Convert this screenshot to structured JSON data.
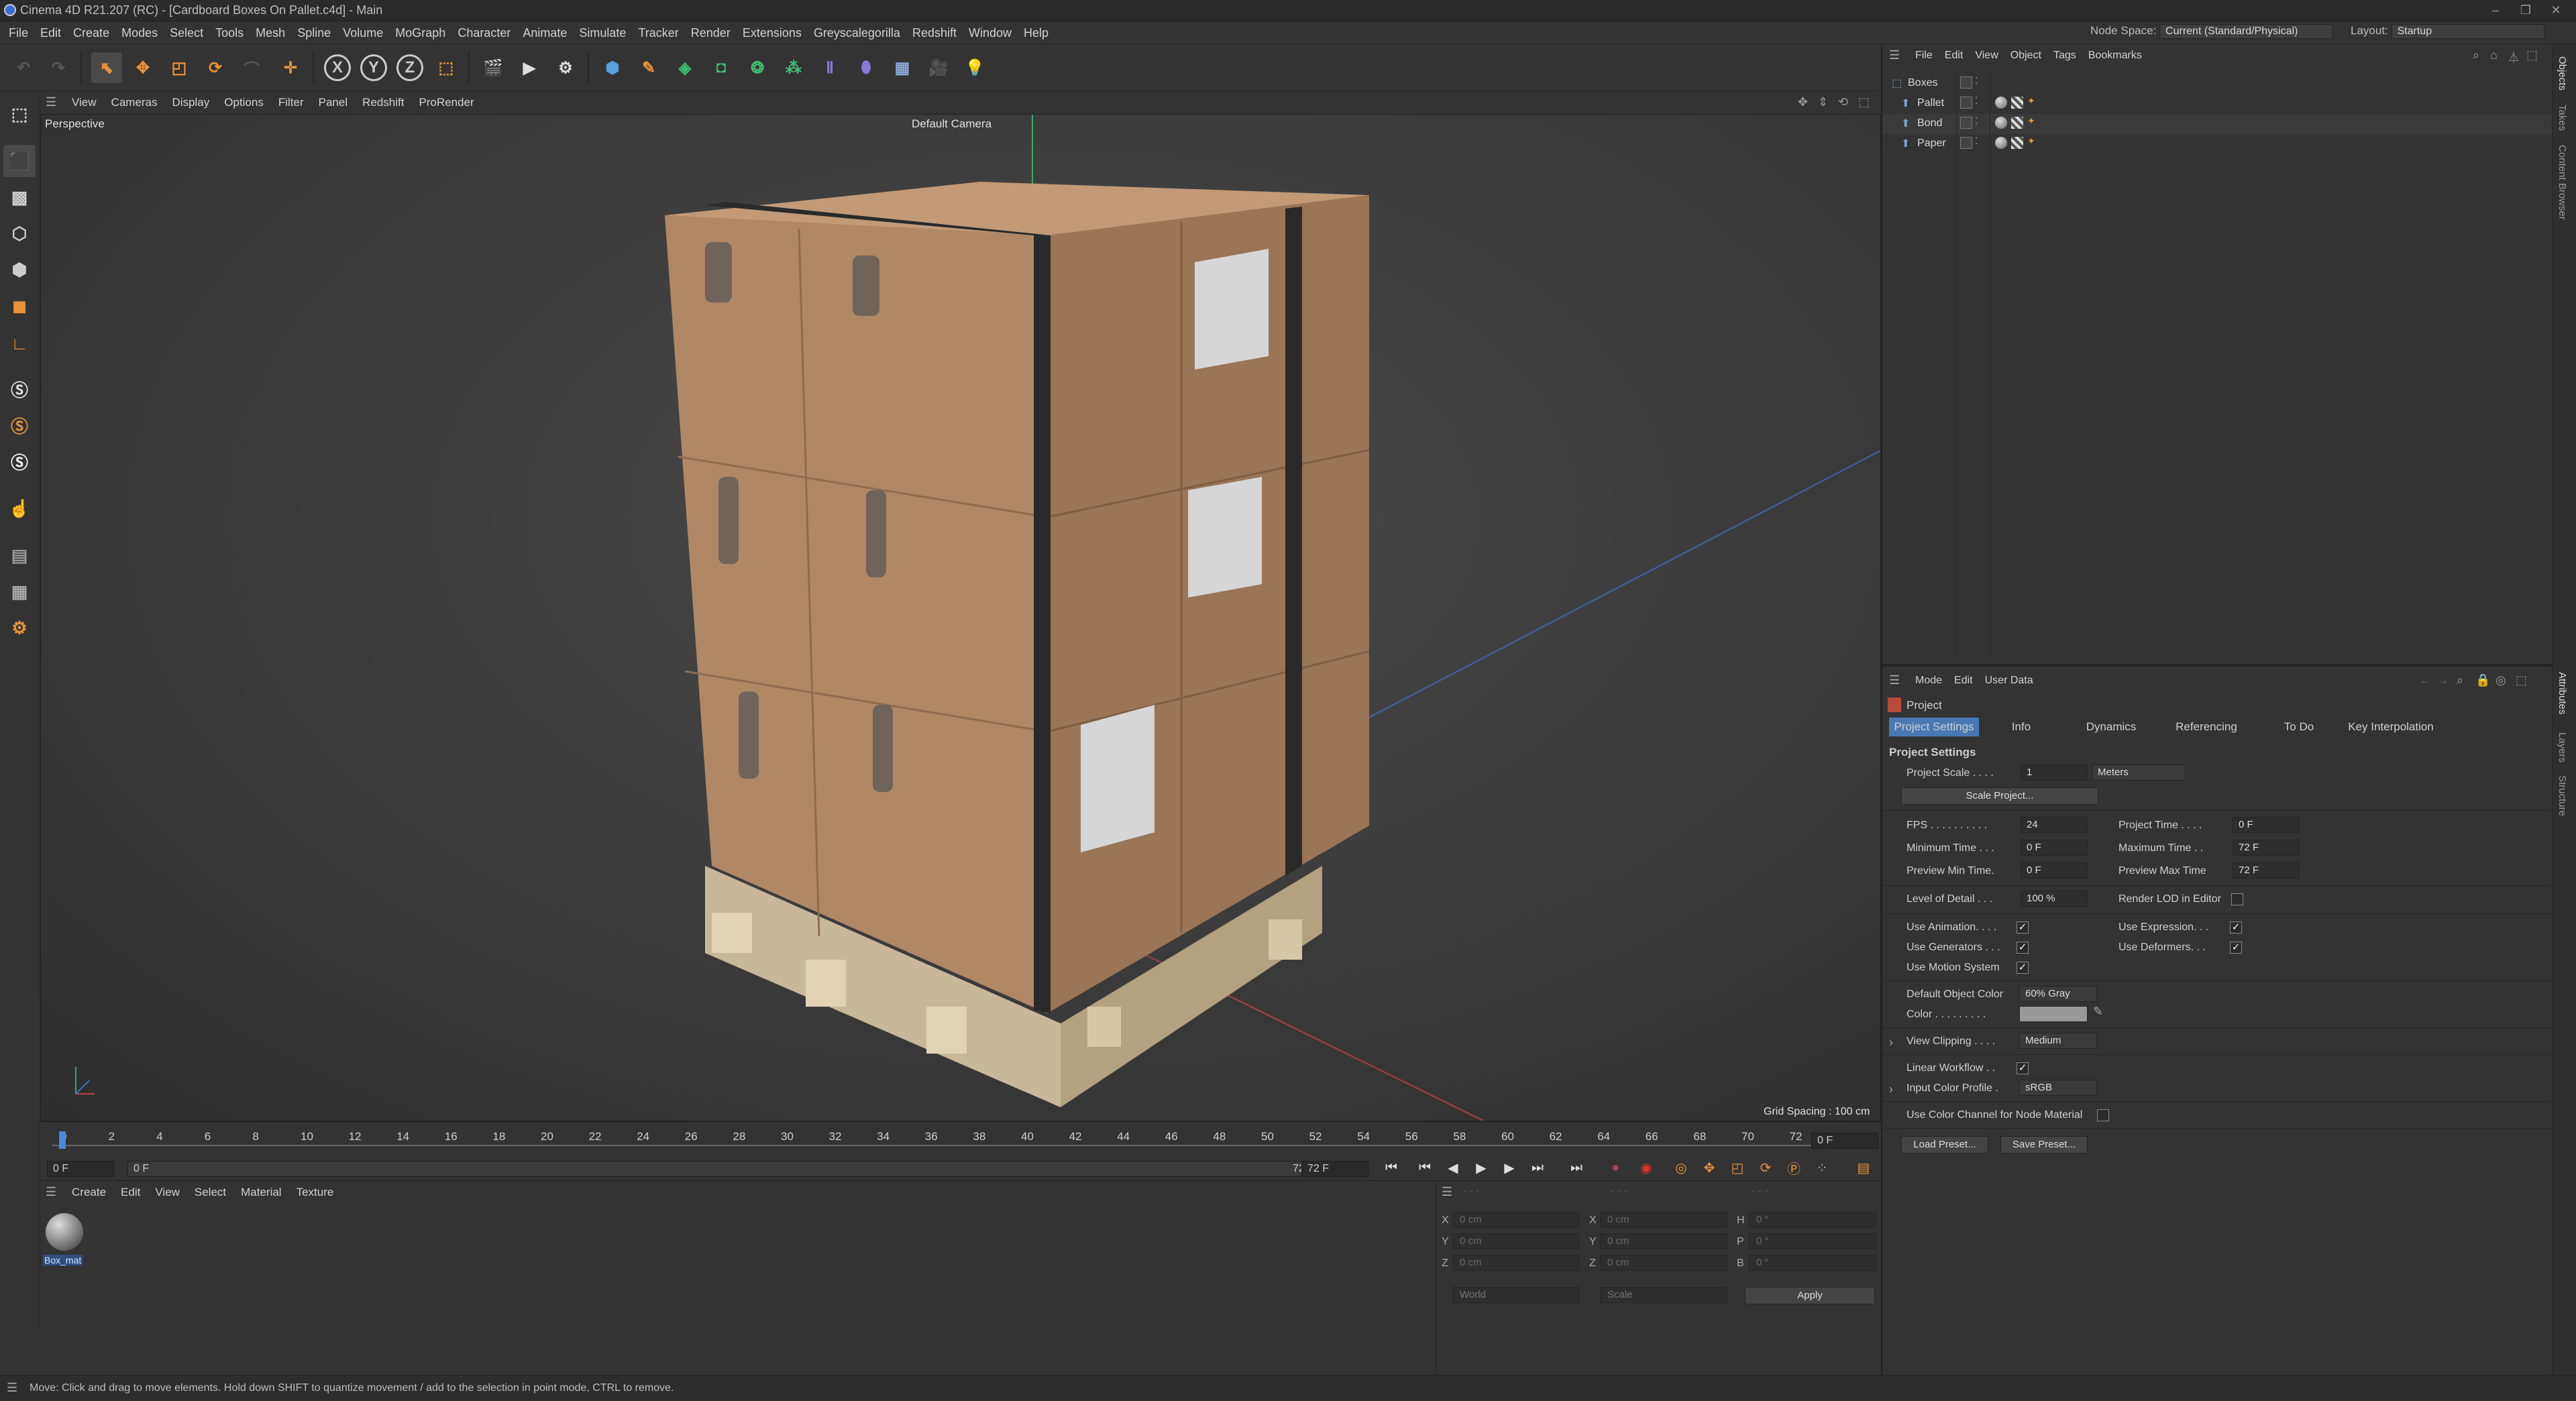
{
  "window": {
    "title": "Cinema 4D R21.207 (RC) - [Cardboard Boxes On Pallet.c4d] - Main"
  },
  "menus": [
    "File",
    "Edit",
    "Create",
    "Modes",
    "Select",
    "Tools",
    "Mesh",
    "Spline",
    "Volume",
    "MoGraph",
    "Character",
    "Animate",
    "Simulate",
    "Tracker",
    "Render",
    "Extensions",
    "Greyscalegorilla",
    "Redshift",
    "Window",
    "Help"
  ],
  "node_space": {
    "label": "Node Space:",
    "value": "Current (Standard/Physical)"
  },
  "layout": {
    "label": "Layout:",
    "value": "Startup"
  },
  "toolbar": {
    "x_label": "X",
    "y_label": "Y",
    "z_label": "Z"
  },
  "viewport": {
    "menus": [
      "View",
      "Cameras",
      "Display",
      "Options",
      "Filter",
      "Panel",
      "Redshift",
      "ProRender"
    ],
    "name": "Perspective",
    "camera": "Default Camera",
    "grid_spacing": "Grid Spacing : 100 cm"
  },
  "timeline": {
    "ticks": [
      "0",
      "2",
      "4",
      "6",
      "8",
      "10",
      "12",
      "14",
      "16",
      "18",
      "20",
      "22",
      "24",
      "26",
      "28",
      "30",
      "32",
      "34",
      "36",
      "38",
      "40",
      "42",
      "44",
      "46",
      "48",
      "50",
      "52",
      "54",
      "56",
      "58",
      "60",
      "62",
      "64",
      "66",
      "68",
      "70",
      "72"
    ],
    "current_frame": "0 F",
    "start": "0 F",
    "range_start": "0 F",
    "range_end": "72 F",
    "end": "72 F"
  },
  "material_panel": {
    "menus": [
      "Create",
      "Edit",
      "View",
      "Select",
      "Material",
      "Texture"
    ],
    "material_name": "Box_mat"
  },
  "coords": {
    "pos_labels": [
      "X",
      "Y",
      "Z"
    ],
    "pos_values": [
      "0 cm",
      "0 cm",
      "0 cm"
    ],
    "size_labels": [
      "X",
      "Y",
      "Z"
    ],
    "size_values": [
      "0 cm",
      "0 cm",
      "0 cm"
    ],
    "rot_labels": [
      "H",
      "P",
      "B"
    ],
    "rot_values": [
      "0 °",
      "0 °",
      "0 °"
    ],
    "mode_world": "World",
    "mode_scale": "Scale",
    "apply": "Apply"
  },
  "object_manager": {
    "menus": [
      "File",
      "Edit",
      "View",
      "Object",
      "Tags",
      "Bookmarks"
    ],
    "objects": [
      "Boxes",
      "Pallet",
      "Bond",
      "Paper"
    ]
  },
  "side_tabs": {
    "top": [
      "Objects",
      "Takes",
      "Content Browser"
    ],
    "bottom": [
      "Attributes",
      "Layers",
      "Structure"
    ]
  },
  "attributes": {
    "menus": [
      "Mode",
      "Edit",
      "User Data"
    ],
    "header": "Project",
    "tabs": [
      "Project Settings",
      "Info",
      "Dynamics",
      "Referencing",
      "To Do",
      "Key Interpolation"
    ],
    "section": "Project Settings",
    "project_scale_label": "Project Scale . . . .",
    "project_scale": "1",
    "project_unit": "Meters",
    "scale_project_btn": "Scale Project...",
    "fps_label": "FPS . . . . . . . . . .",
    "fps": "24",
    "project_time_label": "Project Time . . . .",
    "project_time": "0 F",
    "min_time_label": "Minimum Time . . .",
    "min_time": "0 F",
    "max_time_label": "Maximum Time . .",
    "max_time": "72 F",
    "preview_min_label": "Preview Min Time.",
    "preview_min": "0 F",
    "preview_max_label": "Preview Max Time",
    "preview_max": "72 F",
    "lod_label": "Level of Detail . . .",
    "lod": "100 %",
    "render_lod_label": "Render LOD in Editor",
    "use_animation": "Use Animation. . . .",
    "use_expression": "Use Expression. . .",
    "use_generators": "Use Generators . . .",
    "use_deformers": "Use Deformers. . .",
    "use_motion": "Use Motion System",
    "default_color_label": "Default Object Color",
    "default_color": "60% Gray",
    "color_label": "Color . . . . . . . . .",
    "view_clipping_label": "View Clipping . . . .",
    "view_clipping": "Medium",
    "linear_workflow": "Linear Workflow . .",
    "input_profile_label": "Input Color Profile .",
    "input_profile": "sRGB",
    "color_channel": "Use Color Channel for Node Material",
    "load_preset": "Load Preset...",
    "save_preset": "Save Preset..."
  },
  "status": "Move: Click and drag to move elements. Hold down SHIFT to quantize movement / add to the selection in point mode, CTRL to remove.",
  "colors": {
    "accent": "#e8923a",
    "tab_active": "#4a78b5",
    "cardboard": "#b08866"
  }
}
